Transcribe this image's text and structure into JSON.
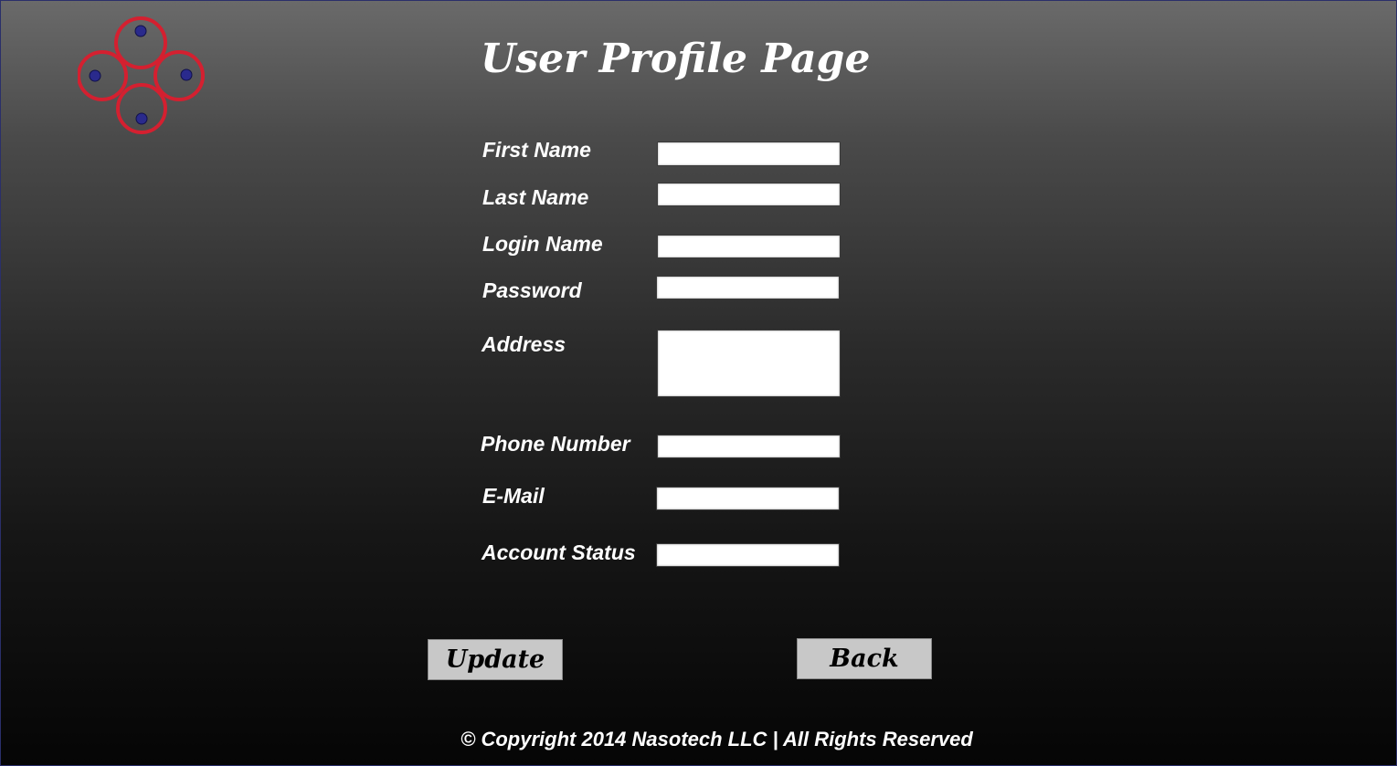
{
  "logo": {
    "icon": "four-circle-logo-icon",
    "ring_color": "#d42030",
    "dot_color": "#2a2a8c"
  },
  "page": {
    "title": "User Profile Page"
  },
  "form": {
    "first_name": {
      "label": "First Name",
      "value": ""
    },
    "last_name": {
      "label": "Last Name",
      "value": ""
    },
    "login_name": {
      "label": "Login Name",
      "value": ""
    },
    "password": {
      "label": "Password",
      "value": ""
    },
    "address": {
      "label": "Address",
      "value": ""
    },
    "phone_number": {
      "label": "Phone Number",
      "value": ""
    },
    "email": {
      "label": "E-Mail",
      "value": ""
    },
    "account_status": {
      "label": "Account Status",
      "value": ""
    }
  },
  "buttons": {
    "update": "Update",
    "back": "Back"
  },
  "footer": {
    "copyright": "© Copyright 2014 Nasotech LLC | All Rights Reserved"
  }
}
